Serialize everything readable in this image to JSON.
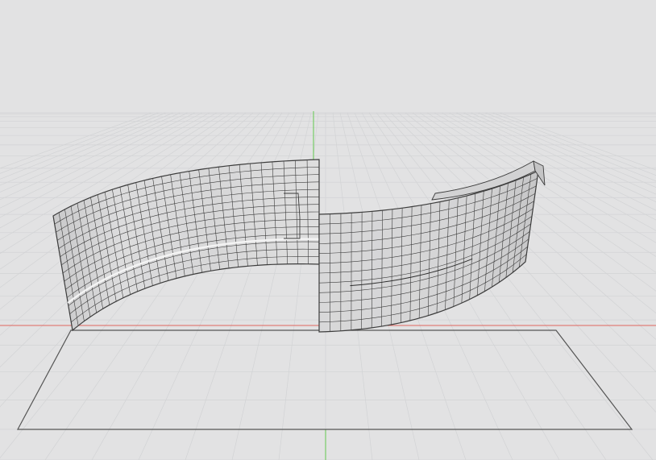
{
  "viewport": {
    "view": "perspective",
    "background_color": "#e2e2e3",
    "grid_color": "#d2d3d5",
    "x_axis_color": "#e0655f",
    "y_axis_color": "#62c84f",
    "ground_outline_color": "#555555",
    "mesh_fill_color": "#d9d9d9",
    "mesh_line_color": "#3c3c3c"
  },
  "objects": [
    {
      "name": "curved-wall-left",
      "type": "mesh"
    },
    {
      "name": "curved-wall-right",
      "type": "mesh"
    },
    {
      "name": "ground-plane",
      "type": "plane"
    }
  ]
}
